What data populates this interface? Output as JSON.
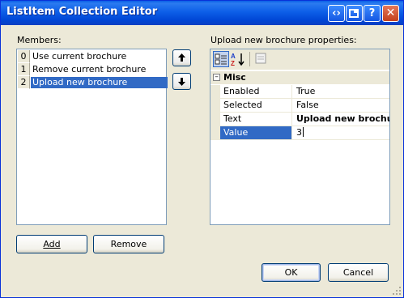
{
  "window": {
    "title": "ListItem Collection Editor"
  },
  "members": {
    "label": "Members:",
    "items": [
      {
        "index": "0",
        "text": "Use current brochure"
      },
      {
        "index": "1",
        "text": "Remove current brochure"
      },
      {
        "index": "2",
        "text": "Upload new brochure"
      }
    ],
    "selected_index": 2,
    "add_label": "Add",
    "remove_label": "Remove"
  },
  "properties": {
    "label": "Upload new brochure properties:",
    "category": "Misc",
    "rows": [
      {
        "name": "Enabled",
        "value": "True"
      },
      {
        "name": "Selected",
        "value": "False"
      },
      {
        "name": "Text",
        "value": "Upload new brochure"
      },
      {
        "name": "Value",
        "value": "3"
      }
    ],
    "selected_row": "Value"
  },
  "buttons": {
    "ok": "OK",
    "cancel": "Cancel"
  },
  "icons": {
    "move_up": "arrow-up-icon",
    "move_down": "arrow-down-icon",
    "categorized": "categorized-icon",
    "alphabetical": "alphabetical-sort-icon",
    "property_pages": "property-pages-icon"
  },
  "colors": {
    "selection": "#316ac5",
    "titlebar": "#0d5fe8",
    "face": "#ece9d8"
  }
}
